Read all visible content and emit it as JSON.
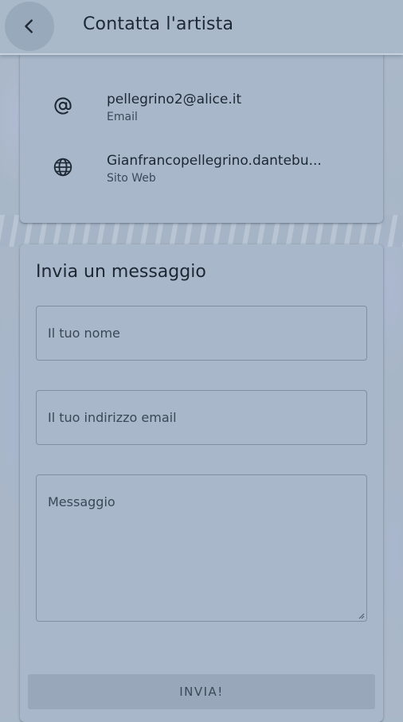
{
  "appbar": {
    "title": "Contatta l'artista",
    "back_icon": "chevron-left-icon"
  },
  "contact": {
    "items": [
      {
        "icon": "at-sign-icon",
        "value": "pellegrino2@alice.it",
        "label": "Email"
      },
      {
        "icon": "globe-icon",
        "value": "Gianfrancopellegrino.dantebu...",
        "label": "Sito Web"
      }
    ]
  },
  "message_form": {
    "title": "Invia un messaggio",
    "name_placeholder": "Il tuo nome",
    "email_placeholder": "Il tuo indirizzo email",
    "message_placeholder": "Messaggio",
    "submit_label": "INVIA!"
  },
  "colors": {
    "background": "#a9b8c8",
    "card": "#a8b8ca",
    "button": "#98a8ba",
    "text": "#1c2733"
  }
}
